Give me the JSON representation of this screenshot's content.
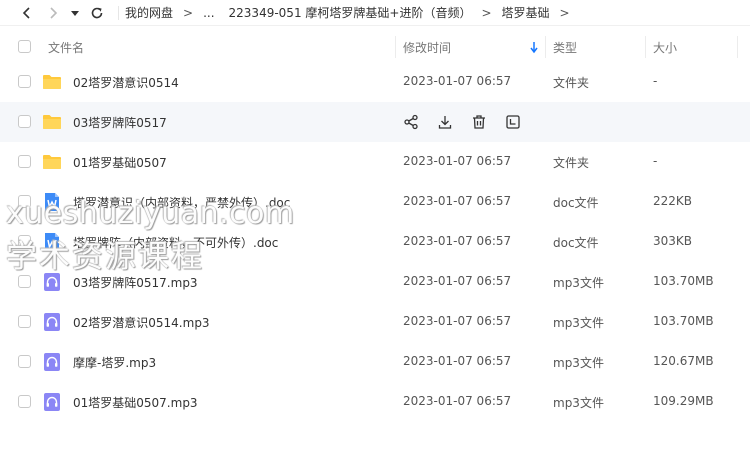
{
  "toolbar": {
    "back_icon": "chevron-left-icon",
    "forward_icon": "chevron-right-icon",
    "history_icon": "caret-down-icon",
    "refresh_icon": "refresh-icon"
  },
  "breadcrumb": {
    "items": [
      "我的网盘",
      "...",
      "223349-051 摩柯塔罗牌基础+进阶（音频）",
      "塔罗基础"
    ],
    "separator": ">"
  },
  "table": {
    "columns": {
      "name": "文件名",
      "mtime": "修改时间",
      "type": "类型",
      "size": "大小"
    },
    "sort_icon": "sort-down-arrow-icon",
    "rows": [
      {
        "name": "02塔罗潜意识0514",
        "mtime": "2023-01-07 06:57",
        "type": "文件夹",
        "size": "-",
        "icon": "folder-icon"
      },
      {
        "name": "03塔罗牌阵0517",
        "mtime": "",
        "type": "",
        "size": "",
        "icon": "folder-icon"
      },
      {
        "name": "01塔罗基础0507",
        "mtime": "2023-01-07 06:57",
        "type": "文件夹",
        "size": "-",
        "icon": "folder-icon"
      },
      {
        "name": "塔罗潜意识（内部资料，严禁外传）.doc",
        "mtime": "2023-01-07 06:57",
        "type": "doc文件",
        "size": "222KB",
        "icon": "word-doc-icon"
      },
      {
        "name": "塔罗牌阵（内部资料，不可外传）.doc",
        "mtime": "2023-01-07 06:57",
        "type": "doc文件",
        "size": "303KB",
        "icon": "word-doc-icon"
      },
      {
        "name": "03塔罗牌阵0517.mp3",
        "mtime": "2023-01-07 06:57",
        "type": "mp3文件",
        "size": "103.70MB",
        "icon": "audio-file-icon"
      },
      {
        "name": "02塔罗潜意识0514.mp3",
        "mtime": "2023-01-07 06:57",
        "type": "mp3文件",
        "size": "103.70MB",
        "icon": "audio-file-icon"
      },
      {
        "name": "摩摩-塔罗.mp3",
        "mtime": "2023-01-07 06:57",
        "type": "mp3文件",
        "size": "120.67MB",
        "icon": "audio-file-icon"
      },
      {
        "name": "01塔罗基础0507.mp3",
        "mtime": "2023-01-07 06:57",
        "type": "mp3文件",
        "size": "109.29MB",
        "icon": "audio-file-icon"
      }
    ],
    "hover_actions": [
      "share-icon",
      "download-icon",
      "delete-icon",
      "more-icon"
    ]
  },
  "watermark": {
    "line1": "xueshuziyuan.com",
    "line2": "学术资源课程"
  },
  "colors": {
    "accent": "#1677ff",
    "folder": "#ffc93c",
    "word": "#3d8bf7",
    "audio": "#8b86f5"
  }
}
